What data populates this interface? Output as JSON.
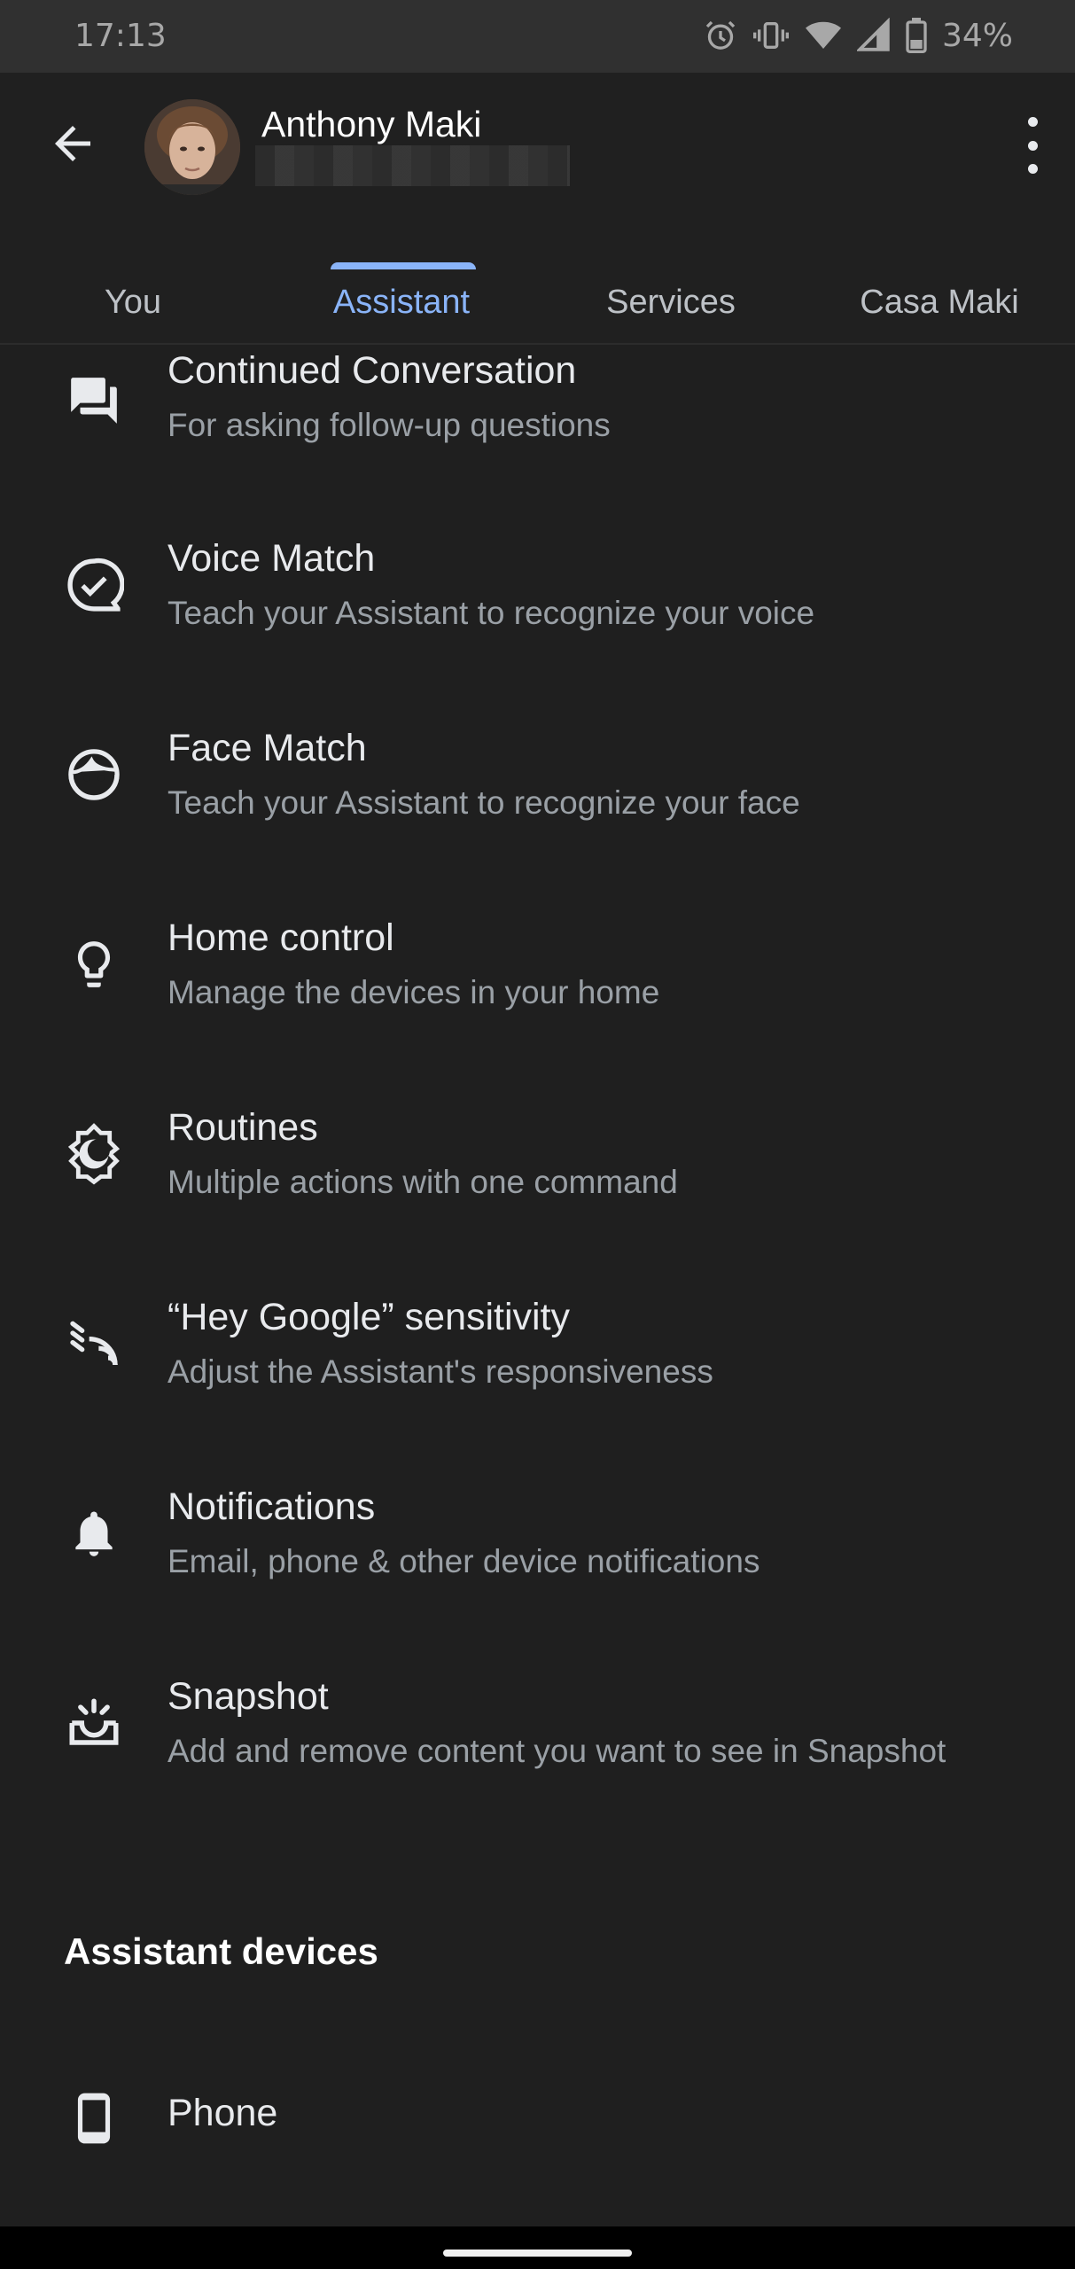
{
  "status_bar": {
    "time": "17:13",
    "battery_percent": "34%",
    "icons": [
      "alarm-icon",
      "vibrate-icon",
      "wifi-icon",
      "signal-icon",
      "battery-icon"
    ]
  },
  "header": {
    "account_name": "Anthony Maki",
    "tabs": [
      {
        "label": "You"
      },
      {
        "label": "Assistant"
      },
      {
        "label": "Services"
      },
      {
        "label": "Casa Maki"
      }
    ],
    "active_tab": "Assistant"
  },
  "settings": [
    {
      "icon": "chat-bubbles-icon",
      "title": "Continued Conversation",
      "subtitle": "For asking follow-up questions"
    },
    {
      "icon": "voice-match-icon",
      "title": "Voice Match",
      "subtitle": "Teach your Assistant to recognize your voice"
    },
    {
      "icon": "face-icon",
      "title": "Face Match",
      "subtitle": "Teach your Assistant to recognize your face"
    },
    {
      "icon": "lightbulb-icon",
      "title": "Home control",
      "subtitle": "Manage the devices in your home"
    },
    {
      "icon": "routines-icon",
      "title": "Routines",
      "subtitle": "Multiple actions with one command"
    },
    {
      "icon": "sensitivity-icon",
      "title": "“Hey Google” sensitivity",
      "subtitle": "Adjust the Assistant's responsiveness"
    },
    {
      "icon": "bell-icon",
      "title": "Notifications",
      "subtitle": "Email, phone & other device notifications"
    },
    {
      "icon": "snapshot-icon",
      "title": "Snapshot",
      "subtitle": "Add and remove content you want to see in Snapshot"
    }
  ],
  "devices_section": {
    "title": "Assistant devices",
    "items": [
      {
        "icon": "phone-icon",
        "title": "Phone"
      }
    ]
  },
  "colors": {
    "accent": "#8ab4f8",
    "background": "#1f1f1f",
    "status_bar": "#303030"
  }
}
